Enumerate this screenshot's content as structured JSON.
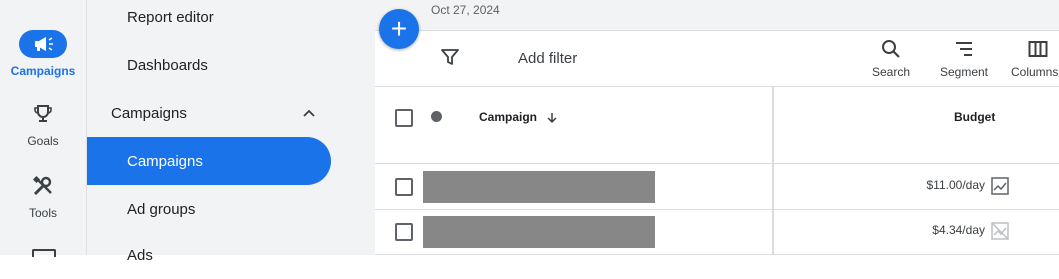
{
  "rail": {
    "items": [
      {
        "label": "Campaigns",
        "icon": "megaphone-icon",
        "active": true
      },
      {
        "label": "Goals",
        "icon": "trophy-icon",
        "active": false
      },
      {
        "label": "Tools",
        "icon": "tools-icon",
        "active": false
      }
    ]
  },
  "nav": {
    "items": [
      {
        "label": "Report editor"
      },
      {
        "label": "Dashboards"
      },
      {
        "label": "Campaigns",
        "expanded": true
      },
      {
        "label": "Campaigns",
        "selected": true
      },
      {
        "label": "Ad groups"
      },
      {
        "label": "Ads"
      }
    ]
  },
  "header": {
    "date": "Oct 27, 2024",
    "fab_label": "+"
  },
  "toolbar": {
    "add_filter": "Add filter",
    "search_label": "Search",
    "segment_label": "Segment",
    "columns_label": "Columns"
  },
  "table": {
    "columns": {
      "campaign": "Campaign",
      "budget": "Budget"
    },
    "rows": [
      {
        "budget": "$11.00/day",
        "chart_icon": "line-chart-icon"
      },
      {
        "budget": "$4.34/day",
        "chart_icon": "chart-disabled-icon"
      }
    ]
  },
  "colors": {
    "accent": "#1a73e8",
    "rail_bg": "#f1f3f4",
    "redacted": "#878787"
  }
}
